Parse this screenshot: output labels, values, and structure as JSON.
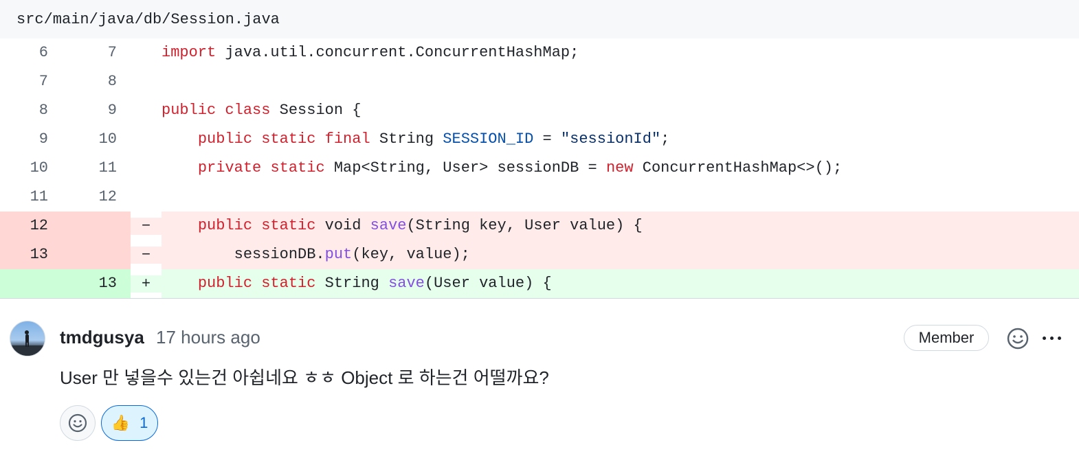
{
  "file": {
    "path": "src/main/java/db/Session.java"
  },
  "diff_rows": [
    {
      "old": "6",
      "new": "7",
      "marker": "",
      "type": "ctx"
    },
    {
      "old": "7",
      "new": "8",
      "marker": "",
      "type": "ctx"
    },
    {
      "old": "8",
      "new": "9",
      "marker": "",
      "type": "ctx"
    },
    {
      "old": "9",
      "new": "10",
      "marker": "",
      "type": "ctx"
    },
    {
      "old": "10",
      "new": "11",
      "marker": "",
      "type": "ctx"
    },
    {
      "old": "11",
      "new": "12",
      "marker": "",
      "type": "ctx"
    },
    {
      "old": "12",
      "new": "",
      "marker": "−",
      "type": "del"
    },
    {
      "old": "13",
      "new": "",
      "marker": "−",
      "type": "del"
    },
    {
      "old": "",
      "new": "13",
      "marker": "+",
      "type": "add"
    }
  ],
  "code": {
    "l1": {
      "kw": "import",
      "rest": " java.util.concurrent.ConcurrentHashMap;"
    },
    "l3": {
      "kw1": "public",
      "sp": " ",
      "kw2": "class",
      "rest": " Session {"
    },
    "l4": {
      "indent": "    ",
      "kw1": "public",
      "kw2": "static",
      "kw3": "final",
      "type": " String ",
      "const": "SESSION_ID",
      "eq": " = ",
      "str": "\"sessionId\"",
      "end": ";"
    },
    "l5": {
      "indent": "    ",
      "kw1": "private",
      "kw2": "static",
      "mid": " Map<String, User> sessionDB = ",
      "kw3": "new",
      "rest": " ConcurrentHashMap<>();"
    },
    "l7": {
      "indent": "    ",
      "kw1": "public",
      "kw2": "static",
      "mid": " void ",
      "fn": "save",
      "rest": "(String key, User value) {"
    },
    "l8": {
      "indent": "        sessionDB.",
      "fn": "put",
      "rest": "(key, value);"
    },
    "l9": {
      "indent": "    ",
      "kw1": "public",
      "kw2": "static",
      "mid": " String ",
      "fn": "save",
      "rest": "(User value) {"
    }
  },
  "comment": {
    "author": "tmdgusya",
    "time": "17 hours ago",
    "badge": "Member",
    "body": "User 만 넣을수 있는건 아쉽네요 ㅎㅎ Object 로 하는건 어떨까요?",
    "reactions": [
      {
        "emoji": "👍",
        "count": "1"
      }
    ]
  },
  "icons": {
    "smile": "smiley-icon",
    "more": "kebab-horizontal-icon",
    "add_reaction": "add-reaction-icon"
  },
  "colors": {
    "keyword": "#cf222e",
    "function": "#8250df",
    "constant": "#0550ae",
    "string": "#0a3069",
    "deletion_bg": "#ffebe9",
    "addition_bg": "#e6ffec",
    "accent": "#0969da"
  }
}
